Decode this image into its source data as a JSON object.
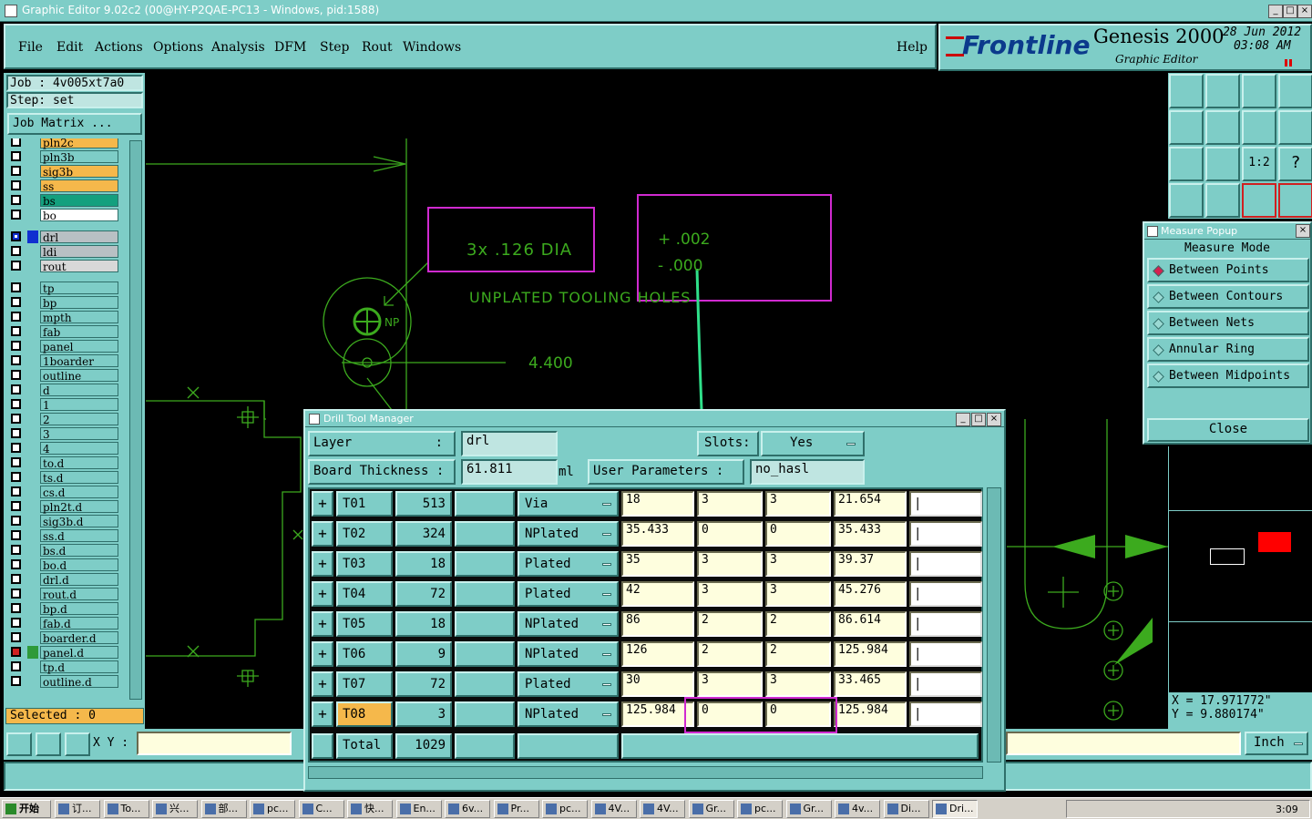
{
  "window": {
    "title": "Graphic Editor 9.02c2 (00@HY-P2QAE-PC13 - Windows, pid:1588)"
  },
  "menu": [
    "File",
    "Edit",
    "Actions",
    "Options",
    "Analysis",
    "DFM",
    "Step",
    "Rout",
    "Windows"
  ],
  "help": "Help",
  "brand": {
    "logo": "Frontline",
    "product": "Genesis 2000",
    "subtitle": "Graphic Editor",
    "date": "28 Jun 2012",
    "time": "03:08 AM"
  },
  "job": {
    "job": "Job : 4v005xt7a0",
    "step": "Step: set",
    "matrix": "Job Matrix ..."
  },
  "layers": [
    {
      "name": "pln2c",
      "color": "#f5b84b"
    },
    {
      "name": "pln3b",
      "color": "#7ecdc7"
    },
    {
      "name": "sig3b",
      "color": "#f5b84b"
    },
    {
      "name": "ss",
      "color": "#f5b84b"
    },
    {
      "name": "bs",
      "color": "#13a07e"
    },
    {
      "name": "bo",
      "color": "#ffffff"
    },
    {
      "name": "drl",
      "color": "#b8c0c4"
    },
    {
      "name": "ldi",
      "color": "#b8c0c4"
    },
    {
      "name": "rout",
      "color": "#d8d8d8"
    },
    {
      "name": "tp",
      "color": "#7ecdc7"
    },
    {
      "name": "bp",
      "color": "#7ecdc7"
    },
    {
      "name": "mpth",
      "color": "#7ecdc7"
    },
    {
      "name": "fab",
      "color": "#7ecdc7"
    },
    {
      "name": "panel",
      "color": "#7ecdc7"
    },
    {
      "name": "1boarder",
      "color": "#7ecdc7"
    },
    {
      "name": "outline",
      "color": "#7ecdc7"
    },
    {
      "name": "d",
      "color": "#7ecdc7"
    },
    {
      "name": "1",
      "color": "#7ecdc7"
    },
    {
      "name": "2",
      "color": "#7ecdc7"
    },
    {
      "name": "3",
      "color": "#7ecdc7"
    },
    {
      "name": "4",
      "color": "#7ecdc7"
    },
    {
      "name": "to.d",
      "color": "#7ecdc7"
    },
    {
      "name": "ts.d",
      "color": "#7ecdc7"
    },
    {
      "name": "cs.d",
      "color": "#7ecdc7"
    },
    {
      "name": "pln2t.d",
      "color": "#7ecdc7"
    },
    {
      "name": "sig3b.d",
      "color": "#7ecdc7"
    },
    {
      "name": "ss.d",
      "color": "#7ecdc7"
    },
    {
      "name": "bs.d",
      "color": "#7ecdc7"
    },
    {
      "name": "bo.d",
      "color": "#7ecdc7"
    },
    {
      "name": "drl.d",
      "color": "#7ecdc7"
    },
    {
      "name": "rout.d",
      "color": "#7ecdc7"
    },
    {
      "name": "bp.d",
      "color": "#7ecdc7"
    },
    {
      "name": "fab.d",
      "color": "#7ecdc7"
    },
    {
      "name": "boarder.d",
      "color": "#7ecdc7"
    },
    {
      "name": "panel.d",
      "color": "#7ecdc7"
    },
    {
      "name": "tp.d",
      "color": "#7ecdc7"
    },
    {
      "name": "outline.d",
      "color": "#7ecdc7"
    }
  ],
  "selected": "Selected : 0",
  "xy_label": "X Y :",
  "canvas_text": {
    "note1": "3x .126 DIA",
    "tol_plus": "+ .002",
    "tol_minus": "- .000",
    "unplated": "UNPLATED TOOLING HOLES",
    "dim": "4.400",
    "np": "NP"
  },
  "dtm": {
    "title": "Drill Tool Manager",
    "layer_label": "Layer",
    "layer_value": "drl",
    "slots_label": "Slots:",
    "slots_value": "Yes",
    "thickness_label": "Board Thickness :",
    "thickness_value": "61.811",
    "thickness_unit": "ml",
    "user_params_label": "User Parameters :",
    "user_params_value": "no_hasl",
    "total_label": "Total",
    "total_count": "1029",
    "tools": [
      {
        "name": "T01",
        "count": "513",
        "type": "Via",
        "size": "18",
        "tol_plus": "3",
        "tol_minus": "3",
        "finish": "21.654"
      },
      {
        "name": "T02",
        "count": "324",
        "type": "NPlated",
        "size": "35.433",
        "tol_plus": "0",
        "tol_minus": "0",
        "finish": "35.433"
      },
      {
        "name": "T03",
        "count": "18",
        "type": "Plated",
        "size": "35",
        "tol_plus": "3",
        "tol_minus": "3",
        "finish": "39.37"
      },
      {
        "name": "T04",
        "count": "72",
        "type": "Plated",
        "size": "42",
        "tol_plus": "3",
        "tol_minus": "3",
        "finish": "45.276"
      },
      {
        "name": "T05",
        "count": "18",
        "type": "NPlated",
        "size": "86",
        "tol_plus": "2",
        "tol_minus": "2",
        "finish": "86.614"
      },
      {
        "name": "T06",
        "count": "9",
        "type": "NPlated",
        "size": "126",
        "tol_plus": "2",
        "tol_minus": "2",
        "finish": "125.984"
      },
      {
        "name": "T07",
        "count": "72",
        "type": "Plated",
        "size": "30",
        "tol_plus": "3",
        "tol_minus": "3",
        "finish": "33.465"
      },
      {
        "name": "T08",
        "count": "3",
        "type": "NPlated",
        "size": "125.984",
        "tol_plus": "0",
        "tol_minus": "0",
        "finish": "125.984"
      }
    ]
  },
  "measure": {
    "title": "Measure Popup",
    "heading": "Measure Mode",
    "options": [
      "Between Points",
      "Between Contours",
      "Between Nets",
      "Annular Ring",
      "Between Midpoints"
    ],
    "close": "Close"
  },
  "coords": {
    "x": "X = 17.971772\"",
    "y": "Y = 9.880174\""
  },
  "units": "Inch",
  "taskbar": {
    "start": "开始",
    "clock": "3:09",
    "tasks": [
      "订...",
      "To...",
      "兴...",
      "部...",
      "pc...",
      "C...",
      "快...",
      "En...",
      "6v...",
      "Pr...",
      "pc...",
      "4V...",
      "4V...",
      "Gr...",
      "pc...",
      "Gr...",
      "4v...",
      "Di...",
      "Dri..."
    ]
  }
}
